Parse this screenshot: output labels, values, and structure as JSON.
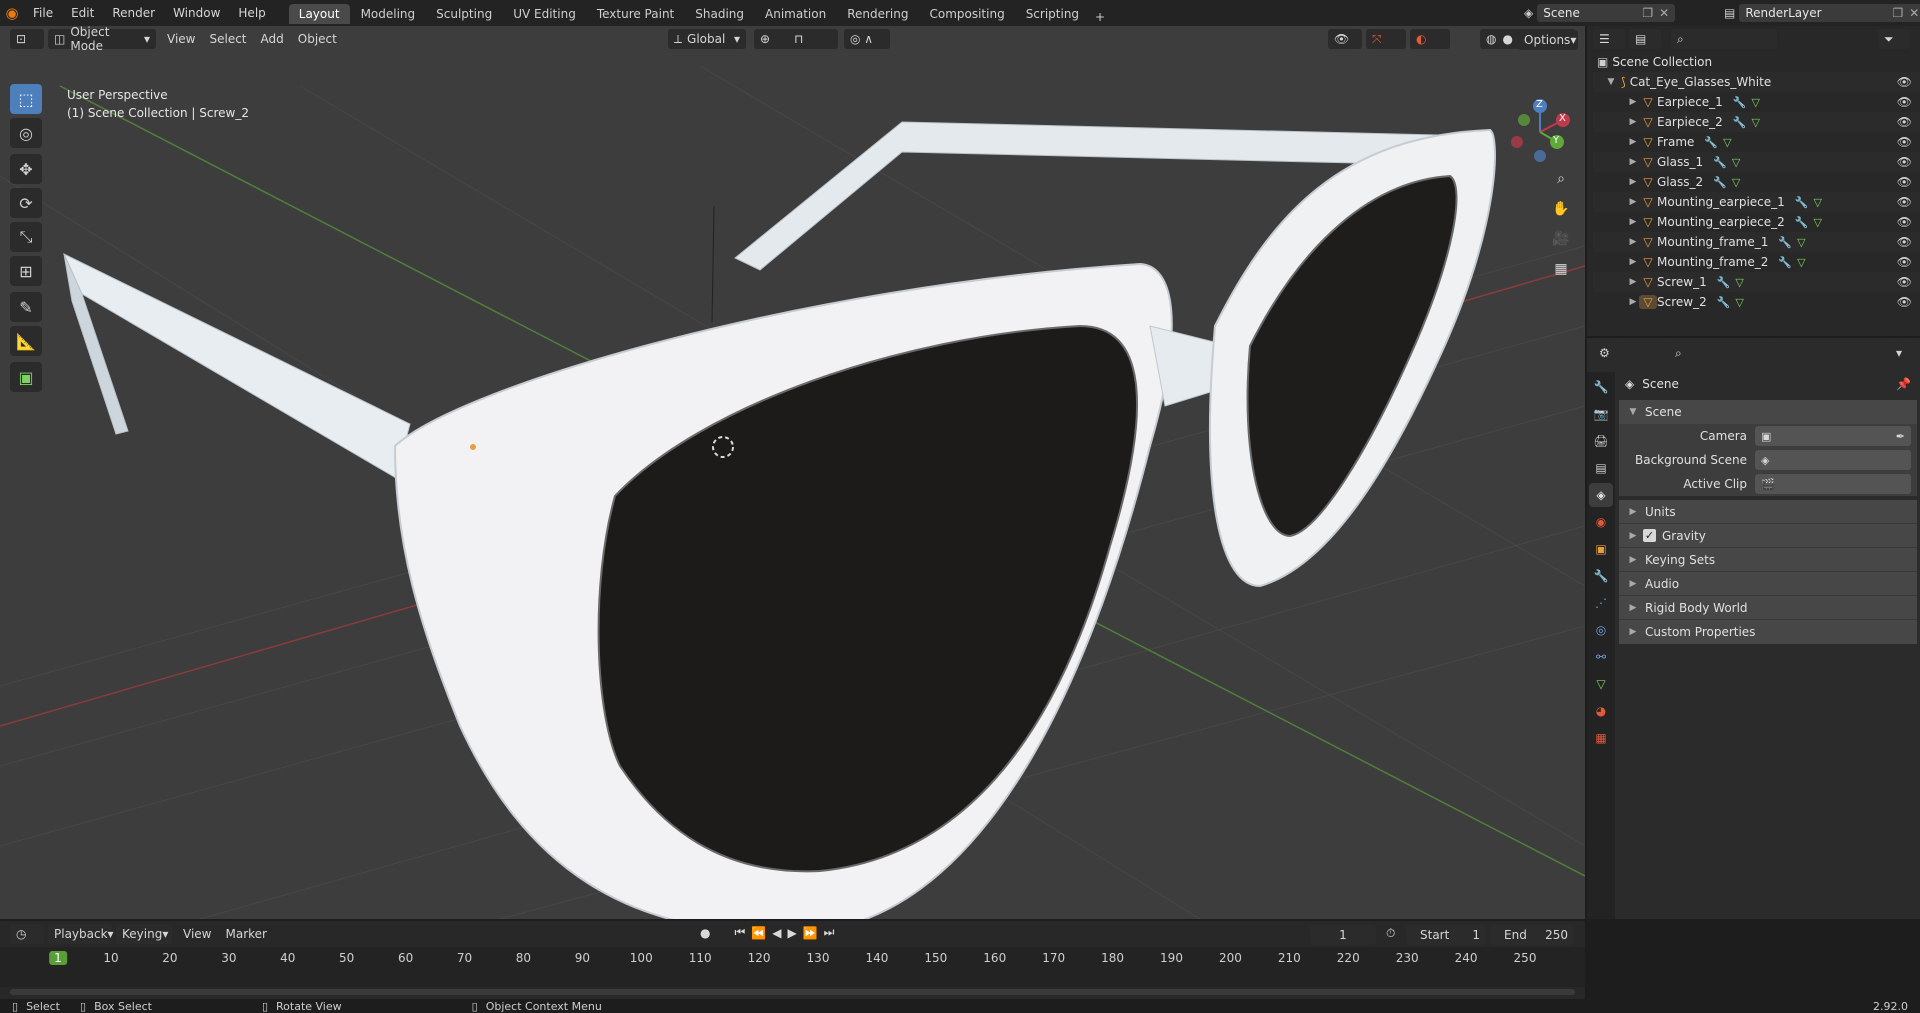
{
  "topbar": {
    "menus": [
      "File",
      "Edit",
      "Render",
      "Window",
      "Help"
    ],
    "tabs": [
      "Layout",
      "Modeling",
      "Sculpting",
      "UV Editing",
      "Texture Paint",
      "Shading",
      "Animation",
      "Rendering",
      "Compositing",
      "Scripting"
    ],
    "active_tab": "Layout",
    "scene_name": "Scene",
    "view_layer": "RenderLayer"
  },
  "viewport": {
    "mode": "Object Mode",
    "menus": [
      "View",
      "Select",
      "Add",
      "Object"
    ],
    "transform_orientation": "Global",
    "options_label": "Options",
    "perspective_label": "User Perspective",
    "collection_label": "(1) Scene Collection | Screw_2",
    "gizmo_axes": {
      "x": "X",
      "y": "Y",
      "z": "Z"
    }
  },
  "outliner": {
    "root": "Scene Collection",
    "collection": "Cat_Eye_Glasses_White",
    "objects": [
      "Earpiece_1",
      "Earpiece_2",
      "Frame",
      "Glass_1",
      "Glass_2",
      "Mounting_earpiece_1",
      "Mounting_earpiece_2",
      "Mounting_frame_1",
      "Mounting_frame_2",
      "Screw_1",
      "Screw_2"
    ],
    "search_placeholder": ""
  },
  "properties": {
    "context_title": "Scene",
    "section": "Scene",
    "fields": [
      {
        "label": "Camera",
        "value": ""
      },
      {
        "label": "Background Scene",
        "value": ""
      },
      {
        "label": "Active Clip",
        "value": ""
      }
    ],
    "panels": [
      "Units",
      "Gravity",
      "Keying Sets",
      "Audio",
      "Rigid Body World",
      "Custom Properties"
    ],
    "gravity_checked": true
  },
  "timeline": {
    "menus": [
      "Playback",
      "Keying",
      "View",
      "Marker"
    ],
    "current_frame": "1",
    "start_label": "Start",
    "start_value": "1",
    "end_label": "End",
    "end_value": "250",
    "ticks": [
      "1",
      "10",
      "20",
      "30",
      "40",
      "50",
      "60",
      "70",
      "80",
      "90",
      "100",
      "110",
      "120",
      "130",
      "140",
      "150",
      "160",
      "170",
      "180",
      "190",
      "200",
      "210",
      "220",
      "230",
      "240",
      "250"
    ]
  },
  "statusbar": {
    "select": "Select",
    "box_select": "Box Select",
    "rotate_view": "Rotate View",
    "context_menu": "Object Context Menu",
    "version": "2.92.0"
  },
  "colors": {
    "accent": "#4d7fbd",
    "active_frame": "#5a9e3a",
    "mesh_icon": "#e69f3c",
    "viewport_bg": "#3d3d3d"
  }
}
